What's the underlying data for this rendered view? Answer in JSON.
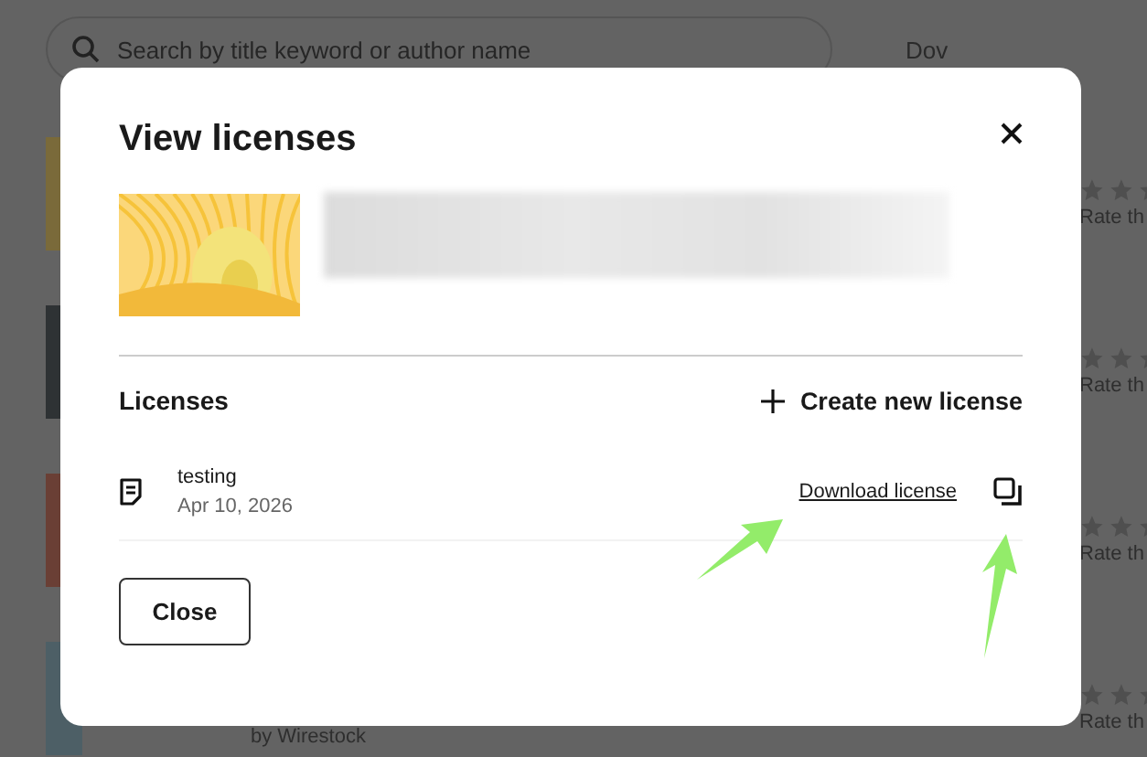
{
  "background": {
    "search": {
      "placeholder": "Search by title keyword or author name"
    },
    "header_link": "Dov",
    "rows": [
      {
        "rate": "Rate th"
      },
      {
        "rate": "Rate th"
      },
      {
        "rate": "Rate th"
      },
      {
        "rate": "Rate th",
        "author": "by Wirestock"
      }
    ]
  },
  "dialog": {
    "title": "View licenses",
    "section": "Licenses",
    "create_action": "Create new license",
    "licenses": [
      {
        "name": "testing",
        "date": "Apr 10, 2026",
        "download": "Download license"
      }
    ],
    "button": "Close"
  }
}
